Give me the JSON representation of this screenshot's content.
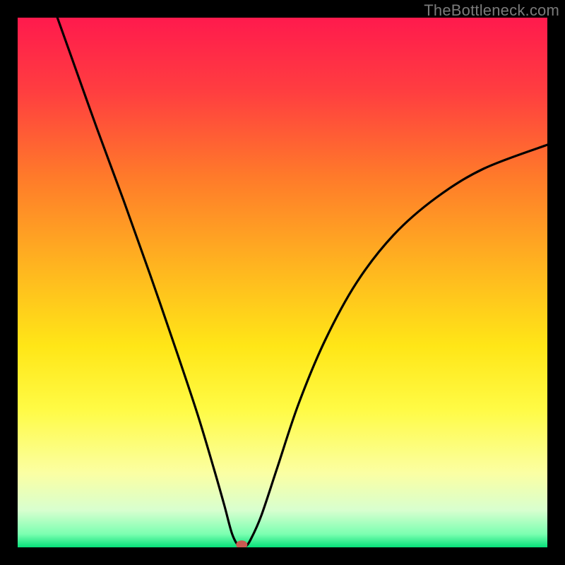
{
  "watermark": "TheBottleneck.com",
  "chart_data": {
    "type": "line",
    "title": "",
    "xlabel": "",
    "ylabel": "",
    "xlim": [
      0,
      100
    ],
    "ylim": [
      0,
      100
    ],
    "gradient_stops": [
      {
        "offset": 0.0,
        "color": "#ff1a4d"
      },
      {
        "offset": 0.14,
        "color": "#ff3e40"
      },
      {
        "offset": 0.3,
        "color": "#ff7a2a"
      },
      {
        "offset": 0.48,
        "color": "#ffb81f"
      },
      {
        "offset": 0.62,
        "color": "#ffe617"
      },
      {
        "offset": 0.74,
        "color": "#fffb45"
      },
      {
        "offset": 0.86,
        "color": "#fbffa3"
      },
      {
        "offset": 0.93,
        "color": "#d8ffcf"
      },
      {
        "offset": 0.975,
        "color": "#7bffb1"
      },
      {
        "offset": 1.0,
        "color": "#06e079"
      }
    ],
    "curve_points": [
      {
        "x": 7.5,
        "y": 100.0
      },
      {
        "x": 10.0,
        "y": 93.0
      },
      {
        "x": 15.0,
        "y": 79.0
      },
      {
        "x": 20.0,
        "y": 65.5
      },
      {
        "x": 25.0,
        "y": 51.5
      },
      {
        "x": 30.0,
        "y": 37.0
      },
      {
        "x": 34.0,
        "y": 25.0
      },
      {
        "x": 37.0,
        "y": 15.0
      },
      {
        "x": 39.0,
        "y": 8.0
      },
      {
        "x": 40.5,
        "y": 2.5
      },
      {
        "x": 41.8,
        "y": 0.2
      },
      {
        "x": 43.0,
        "y": 0.2
      },
      {
        "x": 44.0,
        "y": 1.5
      },
      {
        "x": 46.0,
        "y": 6.0
      },
      {
        "x": 49.0,
        "y": 15.0
      },
      {
        "x": 53.0,
        "y": 27.0
      },
      {
        "x": 58.0,
        "y": 39.0
      },
      {
        "x": 64.0,
        "y": 50.0
      },
      {
        "x": 71.0,
        "y": 59.0
      },
      {
        "x": 79.0,
        "y": 66.0
      },
      {
        "x": 88.0,
        "y": 71.5
      },
      {
        "x": 100.0,
        "y": 76.0
      }
    ],
    "marker": {
      "x": 42.3,
      "y": 0.5,
      "color": "#c95a52"
    }
  }
}
